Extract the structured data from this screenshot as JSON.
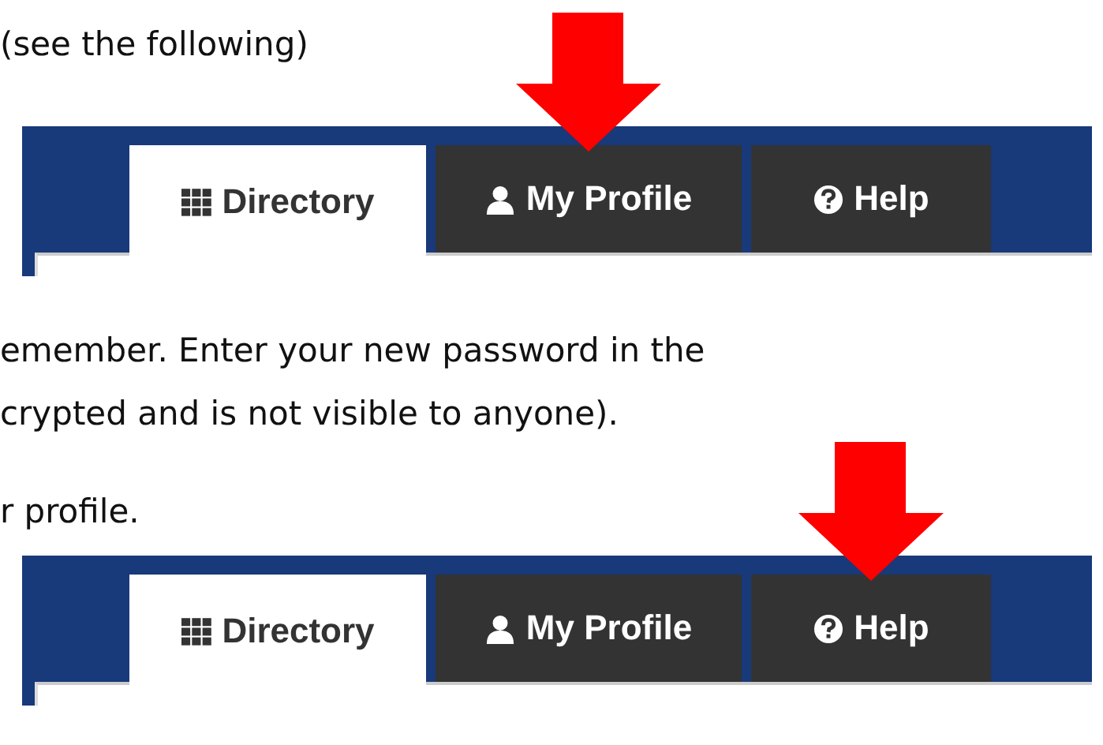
{
  "blocks": [
    {
      "kind": "text",
      "lines": [
        "(see the following)"
      ]
    },
    {
      "kind": "tabs",
      "tabs": [
        {
          "label": "Directory",
          "selected": true,
          "pointed": false
        },
        {
          "label": "My Profile",
          "selected": false,
          "pointed": true
        },
        {
          "label": "Help",
          "selected": false,
          "pointed": false
        }
      ]
    },
    {
      "kind": "text",
      "lines": [
        "emember. Enter your new password in the",
        "crypted and is not visible to anyone)."
      ]
    },
    {
      "kind": "text",
      "lines": [
        "r profile."
      ]
    },
    {
      "kind": "tabs",
      "tabs": [
        {
          "label": "Directory",
          "selected": true,
          "pointed": false
        },
        {
          "label": "My Profile",
          "selected": false,
          "pointed": false
        },
        {
          "label": "Help",
          "selected": false,
          "pointed": true
        }
      ]
    }
  ]
}
